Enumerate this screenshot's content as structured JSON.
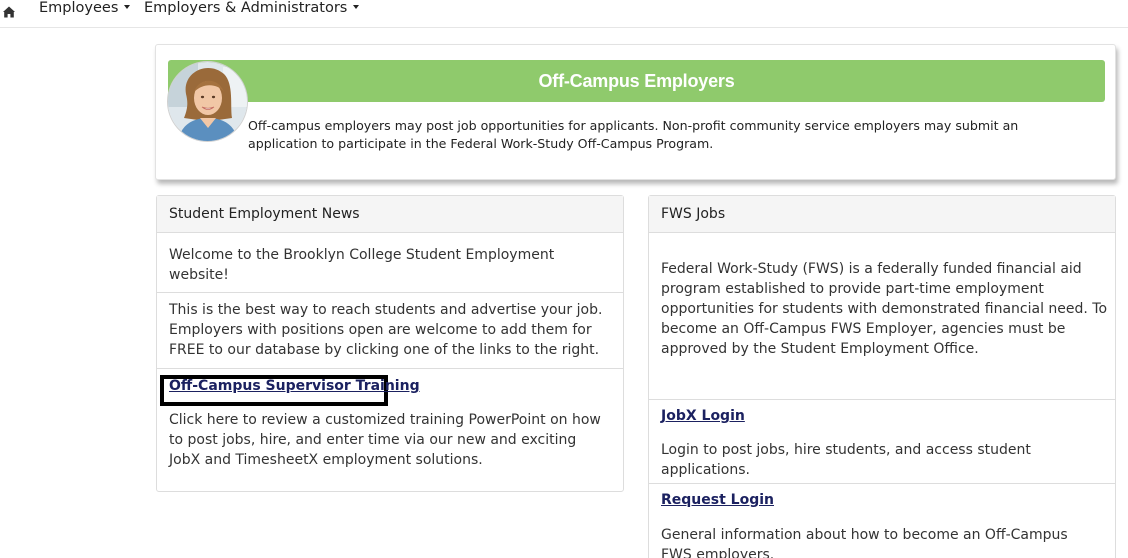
{
  "nav": {
    "home_icon": "home-icon",
    "employees_label": "Employees",
    "employers_label": "Employers & Administrators"
  },
  "hero": {
    "title": "Off-Campus Employers",
    "description": "Off-campus employers may post job opportunities for applicants. Non-profit community service employers may submit an application to participate in the Federal Work-Study Off-Campus Program.",
    "banner_color": "#8fca6c"
  },
  "news": {
    "title": "Student Employment News",
    "welcome": "Welcome to the Brooklyn College Student Employment website!",
    "intro": "This is the best way to reach students and advertise your job. Employers with positions open are welcome to add them for FREE to our database by clicking one of the links to the right.",
    "training_link": "Off-Campus Supervisor Training",
    "training_desc": "Click here to review a customized training PowerPoint on how to post jobs, hire, and enter time via our new and exciting JobX and TimesheetX employment solutions."
  },
  "fws": {
    "title": "FWS Jobs",
    "description": "Federal Work-Study (FWS) is a federally funded financial aid program established to provide part-time employment opportunities for students with demonstrated financial need. To become an Off-Campus FWS Employer, agencies must be approved by the Student Employment Office.",
    "jobx_link": "JobX Login",
    "jobx_desc": "Login to post jobs, hire students, and access student applications.",
    "request_link": "Request Login",
    "request_desc": "General information about how to become an Off-Campus FWS employers."
  },
  "link_color": "#1b2160"
}
